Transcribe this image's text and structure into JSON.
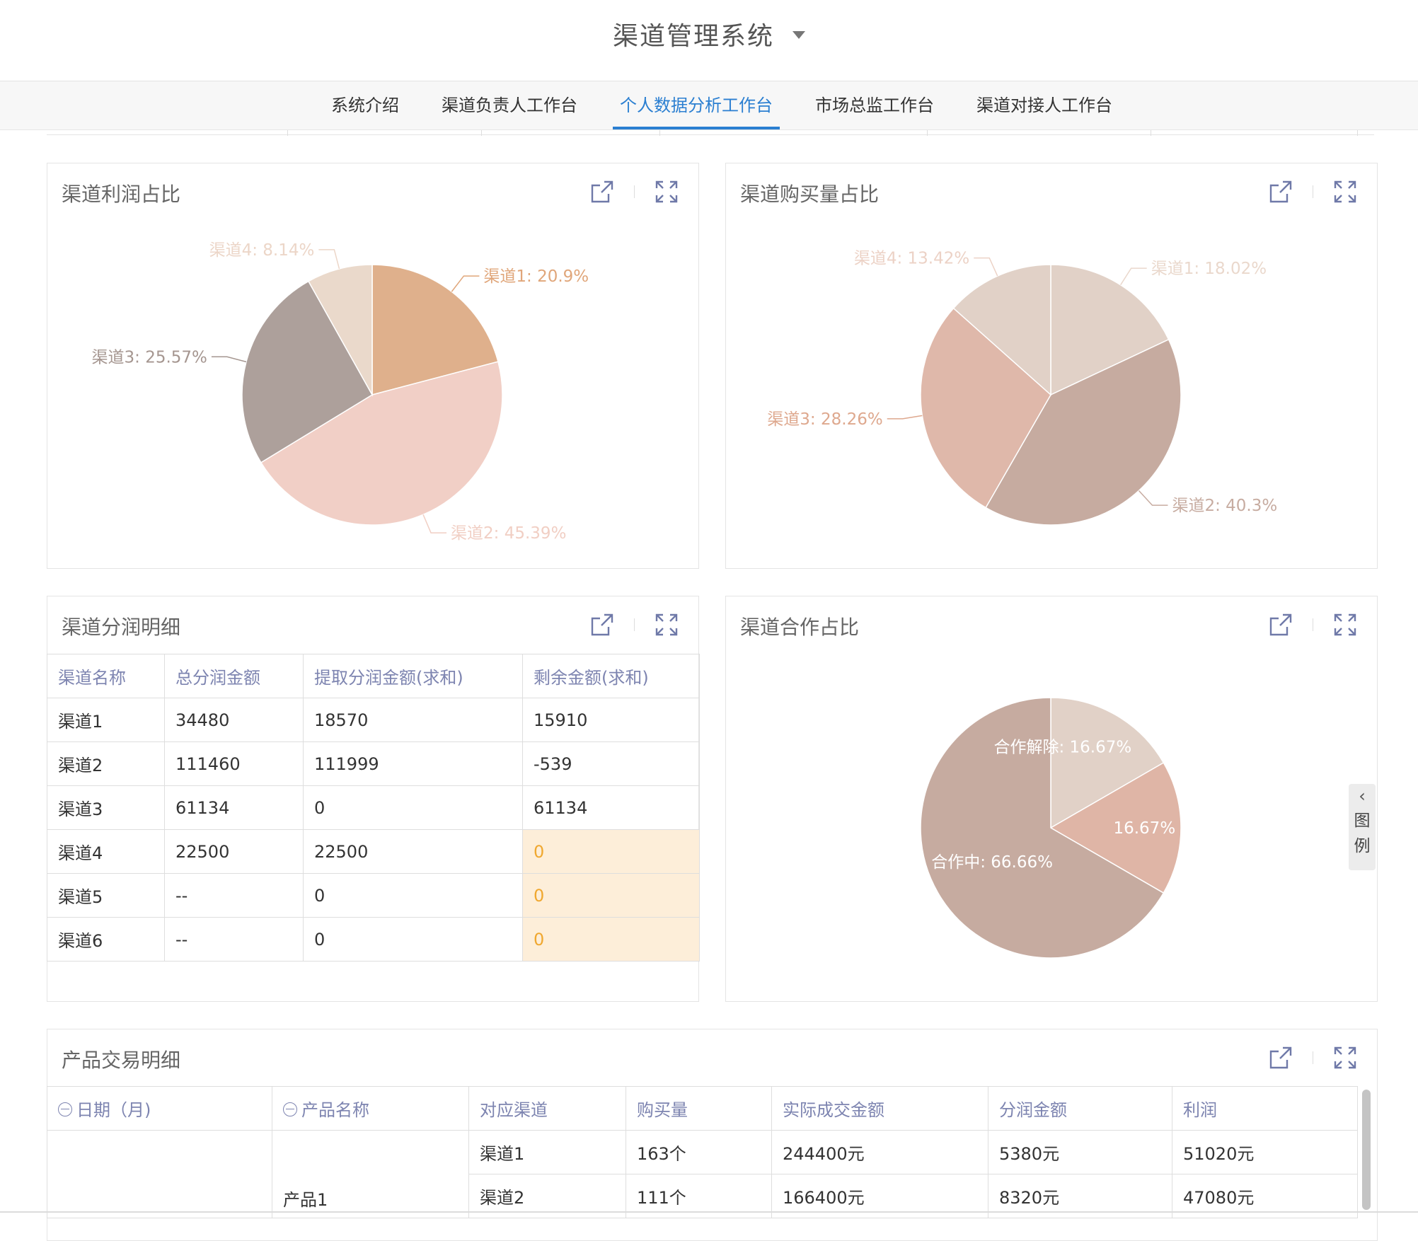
{
  "app": {
    "title": "渠道管理系统"
  },
  "tabs": [
    {
      "label": "系统介绍"
    },
    {
      "label": "渠道负责人工作台"
    },
    {
      "label": "个人数据分析工作台"
    },
    {
      "label": "市场总监工作台"
    },
    {
      "label": "渠道对接人工作台"
    }
  ],
  "panels": {
    "profit_share": {
      "title": "渠道利润占比"
    },
    "purchase_share": {
      "title": "渠道购买量占比"
    },
    "split_detail": {
      "title": "渠道分润明细"
    },
    "coop_share": {
      "title": "渠道合作占比"
    },
    "trade_detail": {
      "title": "产品交易明细"
    }
  },
  "legend_toggle": {
    "chevron": "‹",
    "chars": [
      "图",
      "例"
    ]
  },
  "split_table": {
    "headers": [
      "渠道名称",
      "总分润金额",
      "提取分润金额(求和)",
      "剩余金额(求和)"
    ],
    "rows": [
      [
        "渠道1",
        "34480",
        "18570",
        "15910"
      ],
      [
        "渠道2",
        "111460",
        "111999",
        "-539"
      ],
      [
        "渠道3",
        "61134",
        "0",
        "61134"
      ],
      [
        "渠道4",
        "22500",
        "22500",
        "0"
      ],
      [
        "渠道5",
        "--",
        "0",
        "0"
      ],
      [
        "渠道6",
        "--",
        "0",
        "0"
      ]
    ]
  },
  "trade_table": {
    "headers": [
      "日期（月)",
      "产品名称",
      "对应渠道",
      "购买量",
      "实际成交金额",
      "分润金额",
      "利润"
    ],
    "product": "产品1",
    "rows": [
      [
        "渠道1",
        "163个",
        "244400元",
        "5380元",
        "51020元"
      ],
      [
        "渠道2",
        "111个",
        "166400元",
        "8320元",
        "47080元"
      ]
    ]
  },
  "colors": {
    "accent": "#2b7fd1",
    "highlight_bg": "#fdeed9",
    "highlight_text": "#f0a830",
    "header_text": "#7d84b0"
  },
  "icons": [
    "export-icon",
    "fullscreen-icon",
    "caret-down-icon",
    "collapse-icon",
    "chevron-left-icon"
  ],
  "chart_data": [
    {
      "type": "pie",
      "title": "渠道利润占比",
      "labels": [
        "渠道1",
        "渠道2",
        "渠道3",
        "渠道4"
      ],
      "values": [
        20.9,
        45.39,
        25.57,
        8.14
      ],
      "display": [
        "渠道1: 20.9%",
        "渠道2: 45.39%",
        "渠道3: 25.57%",
        "渠道4: 8.14%"
      ],
      "colors": [
        "#dfb08c",
        "#f1cfc6",
        "#ada09b",
        "#ead9cb"
      ],
      "label_colors": [
        "#e0a67a",
        "#f1cfc4",
        "#a59690",
        "#ecd6c8"
      ]
    },
    {
      "type": "pie",
      "title": "渠道购买量占比",
      "labels": [
        "渠道1",
        "渠道2",
        "渠道3",
        "渠道4"
      ],
      "values": [
        18.02,
        40.3,
        28.26,
        13.42
      ],
      "display": [
        "渠道1: 18.02%",
        "渠道2: 40.3%",
        "渠道3: 28.26%",
        "渠道4: 13.42%"
      ],
      "colors": [
        "#e1d1c7",
        "#c6aba0",
        "#dfb8aa",
        "#e1d1c7"
      ],
      "label_colors": [
        "#ead8cc",
        "#c7aca1",
        "#dea88e",
        "#ecd2c6"
      ]
    },
    {
      "type": "pie",
      "title": "渠道合作占比",
      "labels": [
        "合作解除",
        "",
        "合作中"
      ],
      "values": [
        16.67,
        16.67,
        66.66
      ],
      "display": [
        "合作解除: 16.67%",
        "16.67%",
        "合作中: 66.66%"
      ],
      "colors": [
        "#e1d1c7",
        "#dfb5a6",
        "#c6aba0"
      ]
    }
  ]
}
